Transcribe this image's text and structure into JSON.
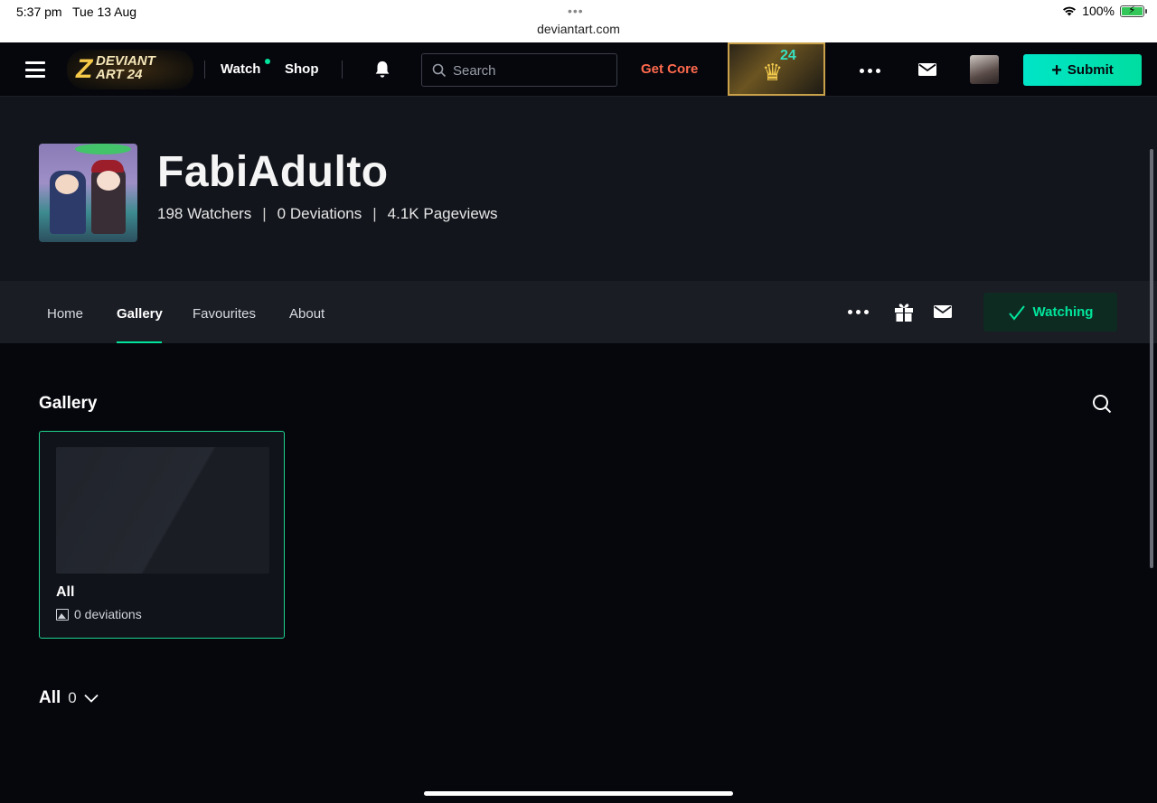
{
  "status_bar": {
    "time": "5:37 pm",
    "date": "Tue 13 Aug",
    "url": "deviantart.com",
    "battery": "100%"
  },
  "top_nav": {
    "logo_line1": "DEVIANT",
    "logo_line2": "ART 24",
    "watch_label": "Watch",
    "shop_label": "Shop",
    "search_placeholder": "Search",
    "get_core_label": "Get Core",
    "promo_badge": "24",
    "submit_label": "Submit"
  },
  "profile": {
    "username": "FabiAdulto",
    "watchers": "198 Watchers",
    "deviations": "0 Deviations",
    "pageviews": "4.1K Pageviews",
    "separator": "|"
  },
  "tabs": {
    "home": "Home",
    "gallery": "Gallery",
    "favourites": "Favourites",
    "about": "About",
    "watching_label": "Watching"
  },
  "gallery": {
    "title": "Gallery",
    "folder_name": "All",
    "folder_count": "0 deviations",
    "filter_label": "All",
    "filter_count": "0"
  },
  "colors": {
    "accent_green": "#00e59b",
    "get_core": "#ff6a4d",
    "submit_gradient_start": "#00e5c8"
  }
}
